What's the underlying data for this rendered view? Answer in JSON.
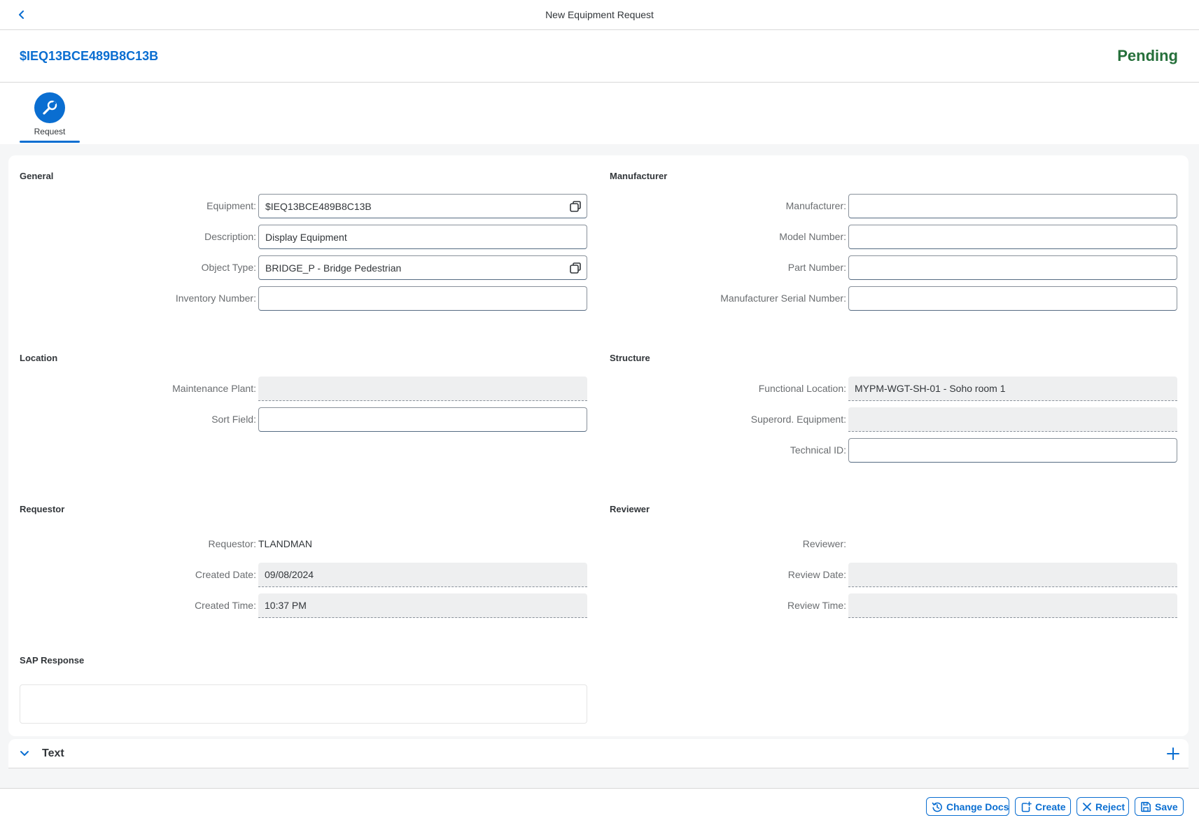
{
  "shell": {
    "title": "New Equipment Request"
  },
  "header": {
    "object_id": "$IEQ13BCE489B8C13B",
    "status": "Pending"
  },
  "tabs": [
    {
      "label": "Request",
      "icon": "wrench-icon"
    }
  ],
  "general": {
    "title": "General",
    "equipment": {
      "label": "Equipment:",
      "value": "$IEQ13BCE489B8C13B"
    },
    "description": {
      "label": "Description:",
      "value": "Display Equipment"
    },
    "object_type": {
      "label": "Object Type:",
      "value": "BRIDGE_P - Bridge Pedestrian"
    },
    "inventory_number": {
      "label": "Inventory Number:",
      "value": ""
    }
  },
  "manufacturer": {
    "title": "Manufacturer",
    "manufacturer": {
      "label": "Manufacturer:",
      "value": ""
    },
    "model_number": {
      "label": "Model Number:",
      "value": ""
    },
    "part_number": {
      "label": "Part Number:",
      "value": ""
    },
    "serial_number": {
      "label": "Manufacturer Serial Number:",
      "value": ""
    }
  },
  "location": {
    "title": "Location",
    "maintenance_plant": {
      "label": "Maintenance Plant:",
      "value": ""
    },
    "sort_field": {
      "label": "Sort Field:",
      "value": ""
    }
  },
  "structure": {
    "title": "Structure",
    "functional_location": {
      "label": "Functional Location:",
      "value": "MYPM-WGT-SH-01 - Soho room 1"
    },
    "superord_equipment": {
      "label": "Superord. Equipment:",
      "value": ""
    },
    "technical_id": {
      "label": "Technical ID:",
      "value": ""
    }
  },
  "requestor": {
    "title": "Requestor",
    "requestor": {
      "label": "Requestor:",
      "value": "TLANDMAN"
    },
    "created_date": {
      "label": "Created Date:",
      "value": "09/08/2024"
    },
    "created_time": {
      "label": "Created Time:",
      "value": "10:37 PM"
    }
  },
  "reviewer": {
    "title": "Reviewer",
    "reviewer": {
      "label": "Reviewer:",
      "value": ""
    },
    "review_date": {
      "label": "Review Date:",
      "value": ""
    },
    "review_time": {
      "label": "Review Time:",
      "value": ""
    }
  },
  "sap_response": {
    "title": "SAP Response",
    "value": ""
  },
  "text_panel": {
    "title": "Text"
  },
  "footer": {
    "change_docs": "Change Docs",
    "create": "Create",
    "reject": "Reject",
    "save": "Save"
  },
  "colors": {
    "accent": "#0a6ed1",
    "status_positive": "#256f3a",
    "readonly_bg": "#eeeff0",
    "page_bg": "#f5f6f7"
  }
}
